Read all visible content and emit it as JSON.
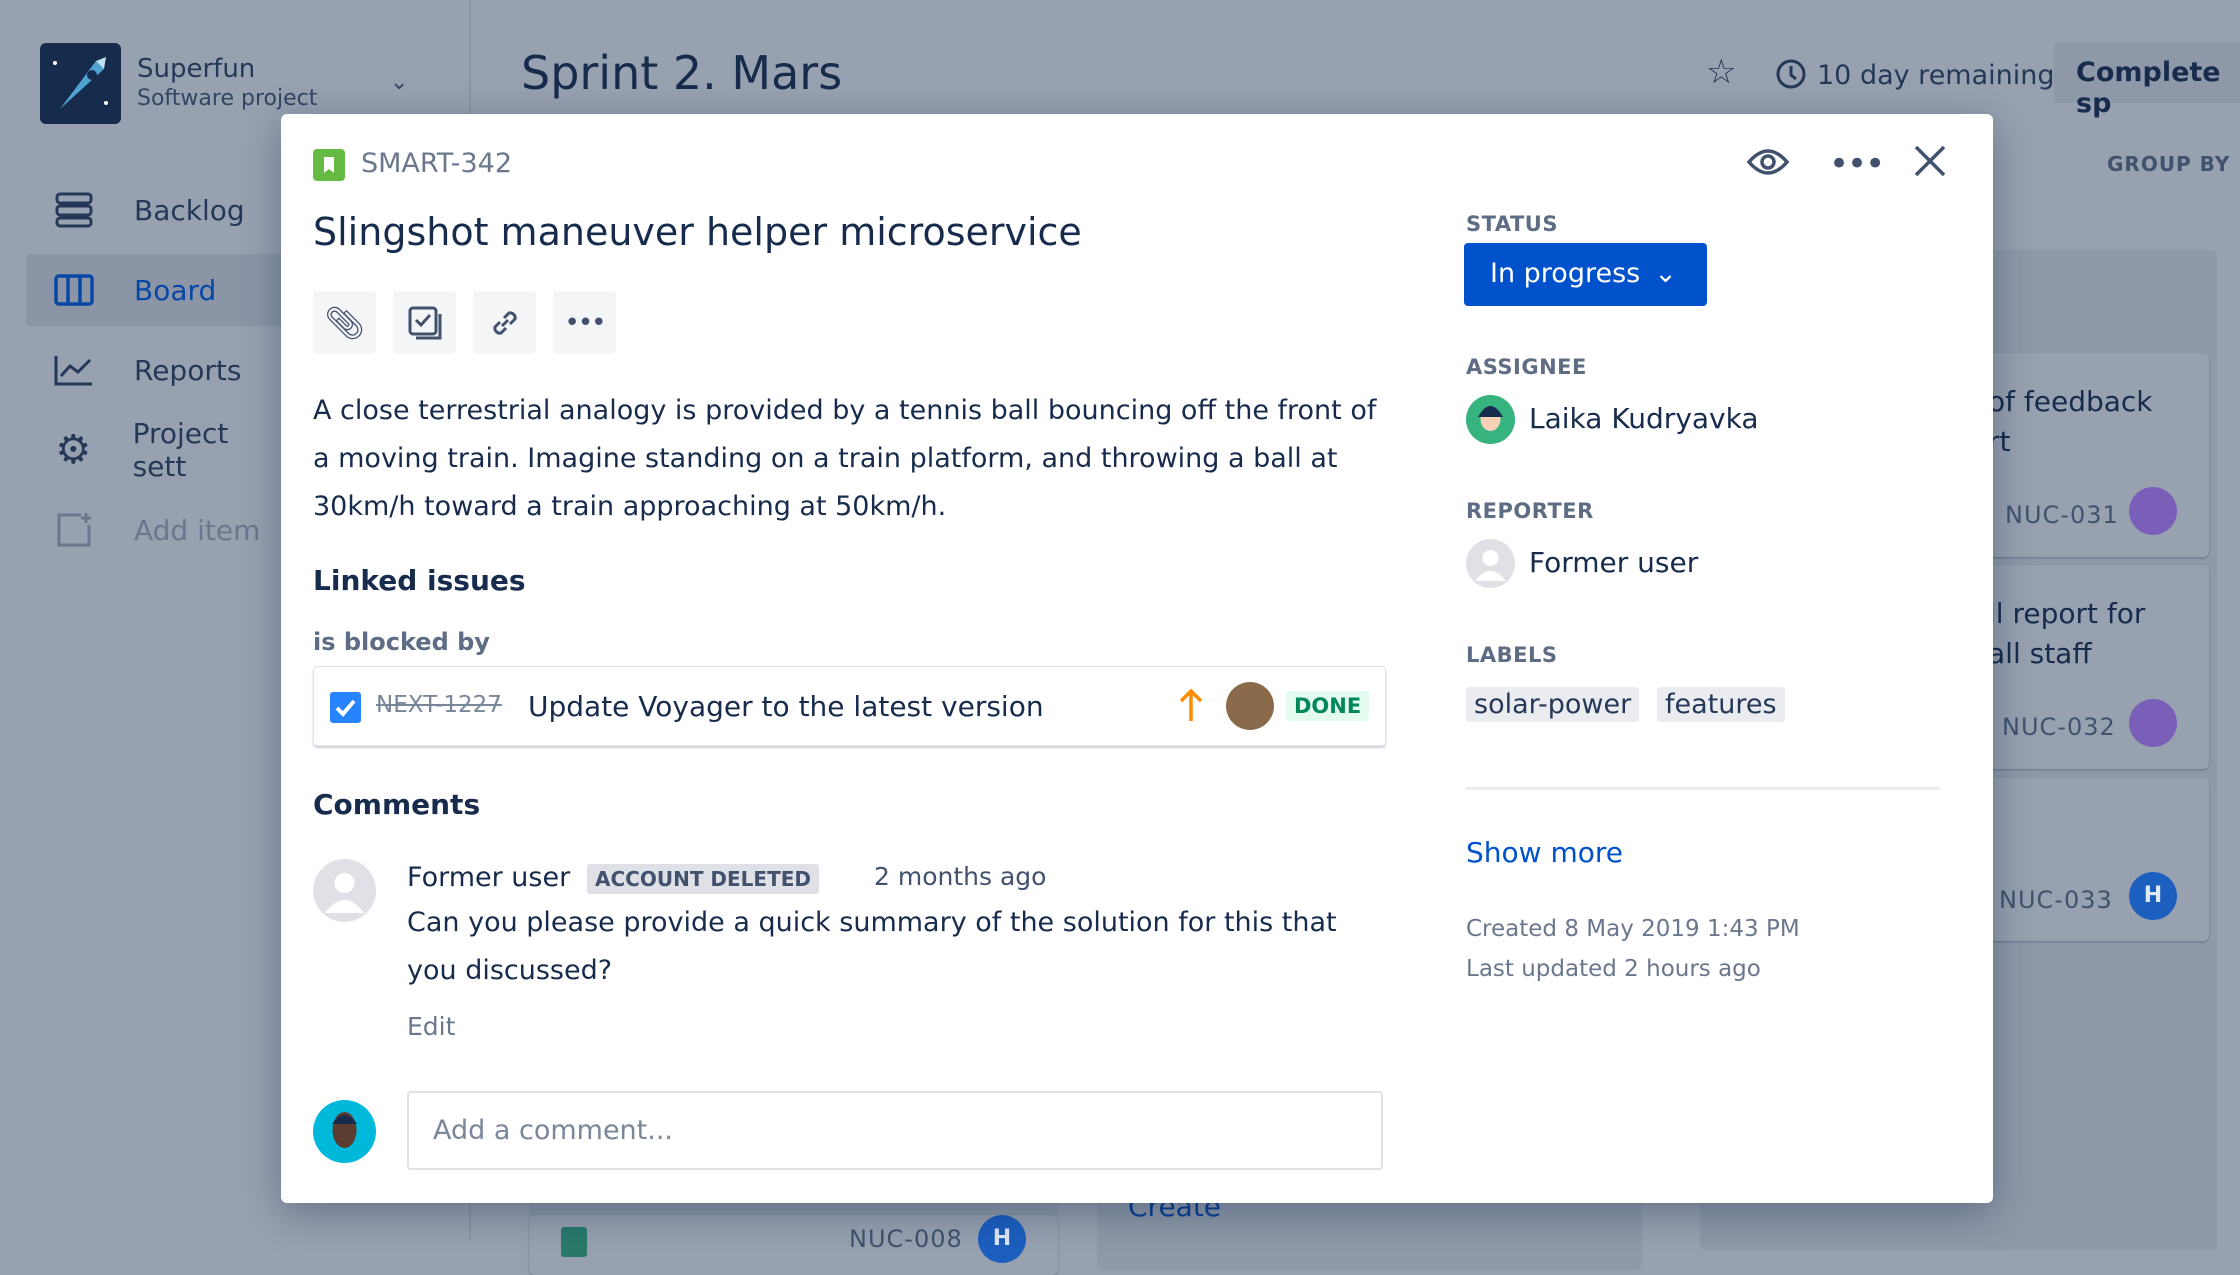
{
  "project": {
    "name": "Superfun",
    "type": "Software project"
  },
  "sidebar": {
    "items": [
      {
        "label": "Backlog",
        "icon": "backlog-icon"
      },
      {
        "label": "Board",
        "icon": "board-icon",
        "selected": true
      },
      {
        "label": "Reports",
        "icon": "reports-icon"
      },
      {
        "label": "Project sett",
        "icon": "gear-icon"
      },
      {
        "label": "Add item",
        "icon": "add-item-icon"
      }
    ]
  },
  "header": {
    "title": "Sprint 2. Mars",
    "remaining": "10 day remaining",
    "complete": "Complete sp",
    "group_by": "GROUP BY"
  },
  "board": {
    "cards": [
      {
        "line1": "of feedback",
        "line2": "rt",
        "key": "NUC-031"
      },
      {
        "line1": "il report for",
        "line2": "all staff",
        "key": "NUC-032"
      },
      {
        "key": "NUC-033",
        "avatar": "H"
      }
    ],
    "bottom_card": {
      "key": "NUC-008",
      "avatar": "H"
    },
    "create": "Create"
  },
  "issue": {
    "key": "SMART-342",
    "title": "Slingshot maneuver helper microservice",
    "description": "A close terrestrial analogy is provided by a tennis ball bouncing off the front of a moving train. Imagine standing on a train platform, and throwing a ball at 30km/h toward a train approaching at 50km/h.",
    "linked_heading": "Linked issues",
    "relation": "is blocked by",
    "linked": {
      "key": "NEXT-1227",
      "summary": "Update Voyager to the latest version",
      "status": "DONE",
      "priority": "high"
    },
    "comments_heading": "Comments",
    "comment": {
      "author": "Former user",
      "badge": "ACCOUNT DELETED",
      "time": "2 months ago",
      "text": "Can you please provide a quick summary of the solution for this that you discussed?",
      "edit": "Edit"
    },
    "add_comment_placeholder": "Add a comment..."
  },
  "details": {
    "status_label": "STATUS",
    "status": "In progress",
    "assignee_label": "ASSIGNEE",
    "assignee": "Laika Kudryavka",
    "reporter_label": "REPORTER",
    "reporter": "Former user",
    "labels_label": "LABELS",
    "labels": [
      "solar-power",
      "features"
    ],
    "show_more": "Show more",
    "created": "Created 8 May 2019 1:43 PM",
    "updated": "Last updated 2 hours ago"
  },
  "colors": {
    "primary": "#0052cc",
    "done_bg": "#e3fcef",
    "done_text": "#00875a",
    "priority": "#ff8b00",
    "story": "#65ba43"
  }
}
